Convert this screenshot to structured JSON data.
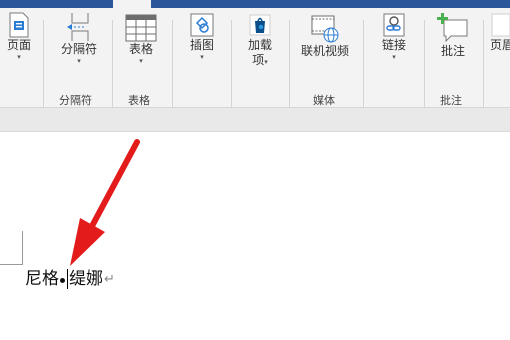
{
  "ribbon": {
    "buttons": {
      "page": {
        "label": "页面",
        "icon": "page-icon",
        "has_dropdown": true
      },
      "separator": {
        "label": "分隔符",
        "icon": "page-break-icon",
        "has_dropdown": true
      },
      "table": {
        "label": "表格",
        "icon": "table-icon",
        "has_dropdown": true
      },
      "illustrations": {
        "label": "插图",
        "icon": "illustrations-icon",
        "has_dropdown": true
      },
      "addins": {
        "label_line1": "加载",
        "label_line2": "项",
        "icon": "store-bag-icon",
        "has_dropdown": true
      },
      "online_video": {
        "label": "联机视频",
        "icon": "online-video-icon"
      },
      "link": {
        "label": "链接",
        "icon": "link-icon",
        "has_dropdown": true
      },
      "comment": {
        "label": "批注",
        "icon": "new-comment-icon"
      },
      "header_partial": {
        "label": "页眉",
        "icon": "header-icon"
      }
    },
    "groups": {
      "separator": "分隔符",
      "table": "表格",
      "media": "媒体",
      "comment": "批注"
    },
    "dropdown_glyph": "▾"
  },
  "document": {
    "text_before_dot": "尼格",
    "text_after_dot_1": "缇",
    "text_after_caret": "娜",
    "paragraph_mark": "↵"
  },
  "colors": {
    "title_bar": "#2b579a",
    "ribbon_bg": "#f3f3f3",
    "accent_blue": "#2b7cd3",
    "accent_green": "#4caf50",
    "annotation_arrow": "#e31b1b"
  }
}
